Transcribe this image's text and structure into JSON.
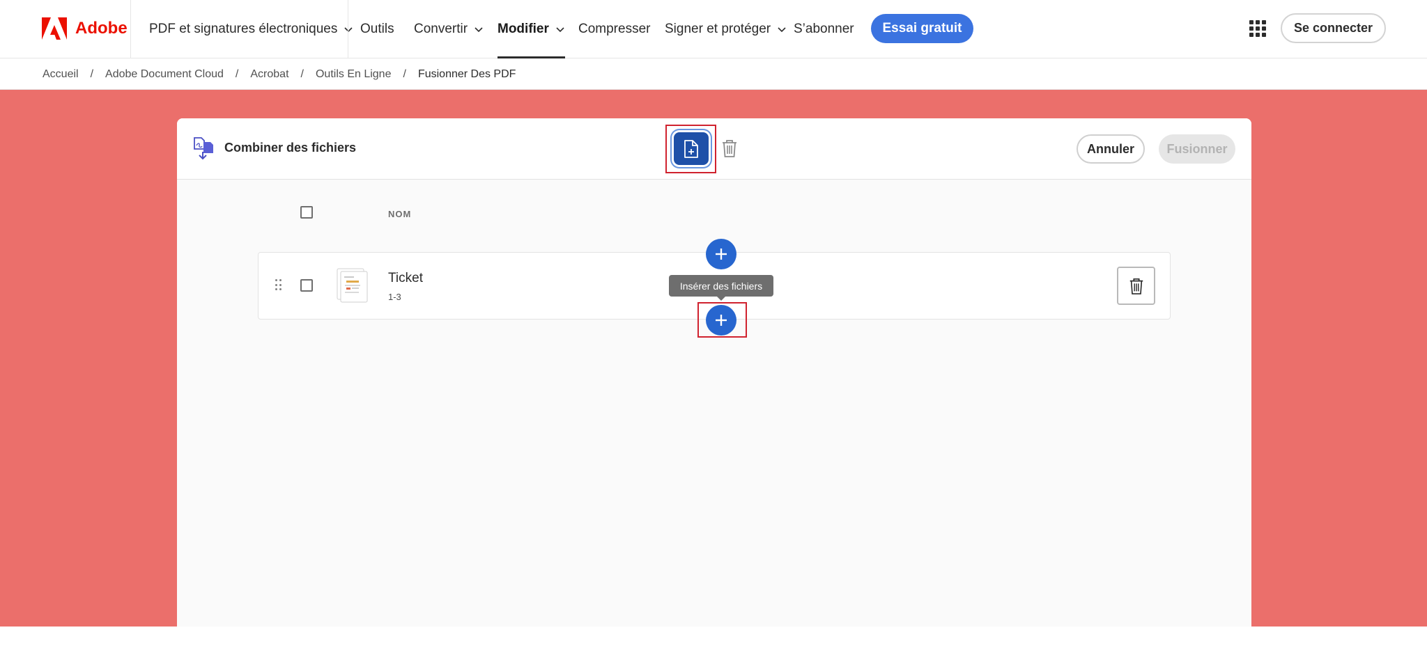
{
  "brand": {
    "name": "Adobe",
    "color": "#eb1000"
  },
  "nav": {
    "items": [
      {
        "label": "PDF et signatures électroniques",
        "has_chevron": true
      },
      {
        "label": "Outils",
        "has_chevron": false
      },
      {
        "label": "Convertir",
        "has_chevron": true
      },
      {
        "label": "Modifier",
        "has_chevron": true,
        "active": true
      },
      {
        "label": "Compresser",
        "has_chevron": false
      },
      {
        "label": "Signer et protéger",
        "has_chevron": true
      },
      {
        "label": "S’abonner",
        "has_chevron": false
      }
    ],
    "trial_label": "Essai gratuit",
    "signin_label": "Se connecter",
    "apps_icon": "app-grid-icon"
  },
  "breadcrumb": {
    "separator": "/",
    "items": [
      "Accueil",
      "Adobe Document Cloud",
      "Acrobat",
      "Outils En Ligne",
      "Fusionner Des PDF"
    ]
  },
  "panel": {
    "title": "Combiner des fichiers",
    "title_icon": "combine-files-icon",
    "add_files_icon": "add-file-icon",
    "delete_icon": "trash-icon",
    "cancel_label": "Annuler",
    "merge_label": "Fusionner",
    "column_name": "NOM",
    "files": [
      {
        "name": "Ticket",
        "pages": "1-3"
      }
    ],
    "tooltip": "Insérer des fichiers"
  },
  "colors": {
    "accent": "#3b73e0",
    "background": "#eb6f6b",
    "highlight": "#d0222e",
    "insert_button": "#2766cf"
  }
}
